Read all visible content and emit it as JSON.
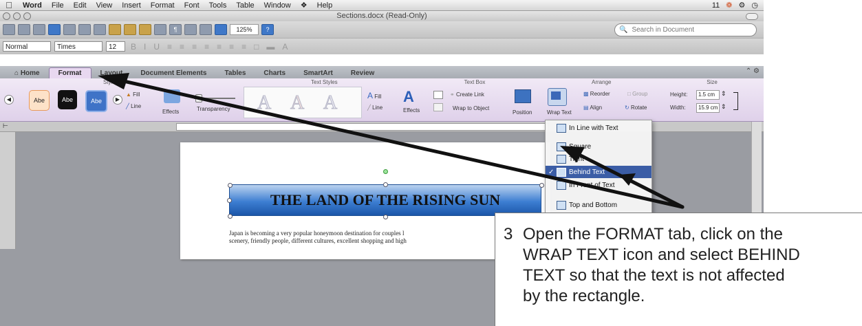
{
  "menubar": {
    "app": "Word",
    "items": [
      "File",
      "Edit",
      "View",
      "Insert",
      "Format",
      "Font",
      "Tools",
      "Table",
      "Window",
      "Help"
    ],
    "status": "11"
  },
  "window": {
    "title": "Sections.docx (Read-Only)"
  },
  "toolbar": {
    "zoom": "125%",
    "search_placeholder": "Search in Document"
  },
  "format_bar": {
    "style": "Normal",
    "font": "Times",
    "size": "12"
  },
  "ribbon": {
    "tabs": [
      "Home",
      "Format",
      "Layout",
      "Document Elements",
      "Tables",
      "Charts",
      "SmartArt",
      "Review"
    ],
    "active_tab": "Format",
    "groups": {
      "styles": "Styles",
      "text_styles": "Text Styles",
      "text_box": "Text Box",
      "arrange": "Arrange",
      "size": "Size"
    },
    "shape_styles": [
      "Abe",
      "Abe",
      "Abe"
    ],
    "fill": "Fill",
    "line": "Line",
    "effects": "Effects",
    "transparency": "Transparency",
    "wordart_letters": [
      "A",
      "A",
      "A"
    ],
    "text_fill": "Fill",
    "text_line": "Line",
    "text_effects": "Effects",
    "create_link": "Create Link",
    "wrap_to_object": "Wrap to Object",
    "position": "Position",
    "wrap_text": "Wrap Text",
    "reorder": "Reorder",
    "align": "Align",
    "group": "Group",
    "rotate": "Rotate",
    "height_label": "Height:",
    "height_value": "1.5 cm",
    "width_label": "Width:",
    "width_value": "15.9 cm"
  },
  "wrap_menu": [
    {
      "label": "In Line with Text",
      "checked": false,
      "highlighted": false
    },
    {
      "label": "Square",
      "checked": false,
      "highlighted": false
    },
    {
      "label": "Tight",
      "checked": false,
      "highlighted": false
    },
    {
      "label": "Behind Text",
      "checked": true,
      "highlighted": true
    },
    {
      "label": "In Front of Text",
      "checked": false,
      "highlighted": false
    },
    {
      "label": "Top and Bottom",
      "checked": false,
      "highlighted": false
    }
  ],
  "document": {
    "banner_title": "THE LAND OF THE RISING SUN",
    "body_line1": "Japan is becoming a very popular honeymoon destination for couples l",
    "body_line2": "scenery, friendly people, different cultures, excellent shopping and high"
  },
  "callout": {
    "step": "3",
    "line1": "Open the FORMAT tab, click on the",
    "line2": "WRAP TEXT icon and select BEHIND",
    "line3": "TEXT so that the text is not affected",
    "line4": "by the rectangle."
  },
  "colors": {
    "accent_tab": "#e8d8f0",
    "banner": "#3d7ed2",
    "menu_highlight": "#3b5da6"
  }
}
